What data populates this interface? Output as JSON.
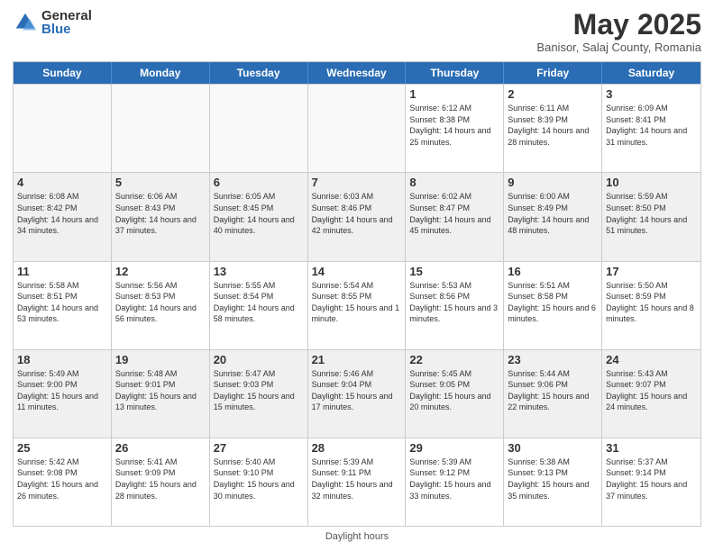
{
  "header": {
    "logo_general": "General",
    "logo_blue": "Blue",
    "month_title": "May 2025",
    "location": "Banisor, Salaj County, Romania"
  },
  "days_of_week": [
    "Sunday",
    "Monday",
    "Tuesday",
    "Wednesday",
    "Thursday",
    "Friday",
    "Saturday"
  ],
  "rows": [
    [
      {
        "day": "",
        "info": ""
      },
      {
        "day": "",
        "info": ""
      },
      {
        "day": "",
        "info": ""
      },
      {
        "day": "",
        "info": ""
      },
      {
        "day": "1",
        "info": "Sunrise: 6:12 AM\nSunset: 8:38 PM\nDaylight: 14 hours and 25 minutes."
      },
      {
        "day": "2",
        "info": "Sunrise: 6:11 AM\nSunset: 8:39 PM\nDaylight: 14 hours and 28 minutes."
      },
      {
        "day": "3",
        "info": "Sunrise: 6:09 AM\nSunset: 8:41 PM\nDaylight: 14 hours and 31 minutes."
      }
    ],
    [
      {
        "day": "4",
        "info": "Sunrise: 6:08 AM\nSunset: 8:42 PM\nDaylight: 14 hours and 34 minutes."
      },
      {
        "day": "5",
        "info": "Sunrise: 6:06 AM\nSunset: 8:43 PM\nDaylight: 14 hours and 37 minutes."
      },
      {
        "day": "6",
        "info": "Sunrise: 6:05 AM\nSunset: 8:45 PM\nDaylight: 14 hours and 40 minutes."
      },
      {
        "day": "7",
        "info": "Sunrise: 6:03 AM\nSunset: 8:46 PM\nDaylight: 14 hours and 42 minutes."
      },
      {
        "day": "8",
        "info": "Sunrise: 6:02 AM\nSunset: 8:47 PM\nDaylight: 14 hours and 45 minutes."
      },
      {
        "day": "9",
        "info": "Sunrise: 6:00 AM\nSunset: 8:49 PM\nDaylight: 14 hours and 48 minutes."
      },
      {
        "day": "10",
        "info": "Sunrise: 5:59 AM\nSunset: 8:50 PM\nDaylight: 14 hours and 51 minutes."
      }
    ],
    [
      {
        "day": "11",
        "info": "Sunrise: 5:58 AM\nSunset: 8:51 PM\nDaylight: 14 hours and 53 minutes."
      },
      {
        "day": "12",
        "info": "Sunrise: 5:56 AM\nSunset: 8:53 PM\nDaylight: 14 hours and 56 minutes."
      },
      {
        "day": "13",
        "info": "Sunrise: 5:55 AM\nSunset: 8:54 PM\nDaylight: 14 hours and 58 minutes."
      },
      {
        "day": "14",
        "info": "Sunrise: 5:54 AM\nSunset: 8:55 PM\nDaylight: 15 hours and 1 minute."
      },
      {
        "day": "15",
        "info": "Sunrise: 5:53 AM\nSunset: 8:56 PM\nDaylight: 15 hours and 3 minutes."
      },
      {
        "day": "16",
        "info": "Sunrise: 5:51 AM\nSunset: 8:58 PM\nDaylight: 15 hours and 6 minutes."
      },
      {
        "day": "17",
        "info": "Sunrise: 5:50 AM\nSunset: 8:59 PM\nDaylight: 15 hours and 8 minutes."
      }
    ],
    [
      {
        "day": "18",
        "info": "Sunrise: 5:49 AM\nSunset: 9:00 PM\nDaylight: 15 hours and 11 minutes."
      },
      {
        "day": "19",
        "info": "Sunrise: 5:48 AM\nSunset: 9:01 PM\nDaylight: 15 hours and 13 minutes."
      },
      {
        "day": "20",
        "info": "Sunrise: 5:47 AM\nSunset: 9:03 PM\nDaylight: 15 hours and 15 minutes."
      },
      {
        "day": "21",
        "info": "Sunrise: 5:46 AM\nSunset: 9:04 PM\nDaylight: 15 hours and 17 minutes."
      },
      {
        "day": "22",
        "info": "Sunrise: 5:45 AM\nSunset: 9:05 PM\nDaylight: 15 hours and 20 minutes."
      },
      {
        "day": "23",
        "info": "Sunrise: 5:44 AM\nSunset: 9:06 PM\nDaylight: 15 hours and 22 minutes."
      },
      {
        "day": "24",
        "info": "Sunrise: 5:43 AM\nSunset: 9:07 PM\nDaylight: 15 hours and 24 minutes."
      }
    ],
    [
      {
        "day": "25",
        "info": "Sunrise: 5:42 AM\nSunset: 9:08 PM\nDaylight: 15 hours and 26 minutes."
      },
      {
        "day": "26",
        "info": "Sunrise: 5:41 AM\nSunset: 9:09 PM\nDaylight: 15 hours and 28 minutes."
      },
      {
        "day": "27",
        "info": "Sunrise: 5:40 AM\nSunset: 9:10 PM\nDaylight: 15 hours and 30 minutes."
      },
      {
        "day": "28",
        "info": "Sunrise: 5:39 AM\nSunset: 9:11 PM\nDaylight: 15 hours and 32 minutes."
      },
      {
        "day": "29",
        "info": "Sunrise: 5:39 AM\nSunset: 9:12 PM\nDaylight: 15 hours and 33 minutes."
      },
      {
        "day": "30",
        "info": "Sunrise: 5:38 AM\nSunset: 9:13 PM\nDaylight: 15 hours and 35 minutes."
      },
      {
        "day": "31",
        "info": "Sunrise: 5:37 AM\nSunset: 9:14 PM\nDaylight: 15 hours and 37 minutes."
      }
    ]
  ],
  "footer": {
    "daylight_label": "Daylight hours"
  }
}
